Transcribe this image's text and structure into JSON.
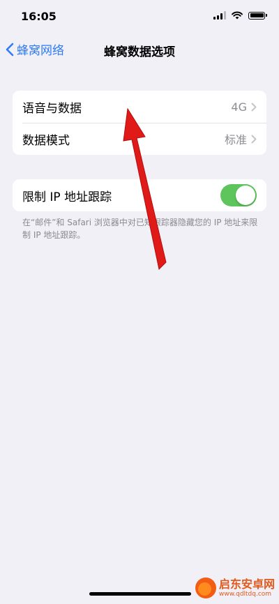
{
  "status_bar": {
    "time": "16:05"
  },
  "nav": {
    "back_label": "蜂窝网络",
    "title": "蜂窝数据选项"
  },
  "group1": {
    "rows": [
      {
        "label": "语音与数据",
        "value": "4G"
      },
      {
        "label": "数据模式",
        "value": "标准"
      }
    ]
  },
  "group2": {
    "label": "限制 IP 地址跟踪",
    "toggle_on": true,
    "footnote": "在“邮件”和 Safari 浏览器中对已知跟踪器隐藏您的 IP 地址来限制 IP 地址跟踪。"
  },
  "watermark": {
    "name": "启东安卓网",
    "url": "www.qdltdq.com"
  },
  "colors": {
    "accent": "#2f7bf5",
    "toggle_on": "#5dc55b",
    "arrow": "#e01919",
    "background": "#f1f0f6"
  },
  "icons": [
    "chevron-left-icon",
    "signal-icon",
    "wifi-icon",
    "battery-icon",
    "chevron-right-icon"
  ]
}
